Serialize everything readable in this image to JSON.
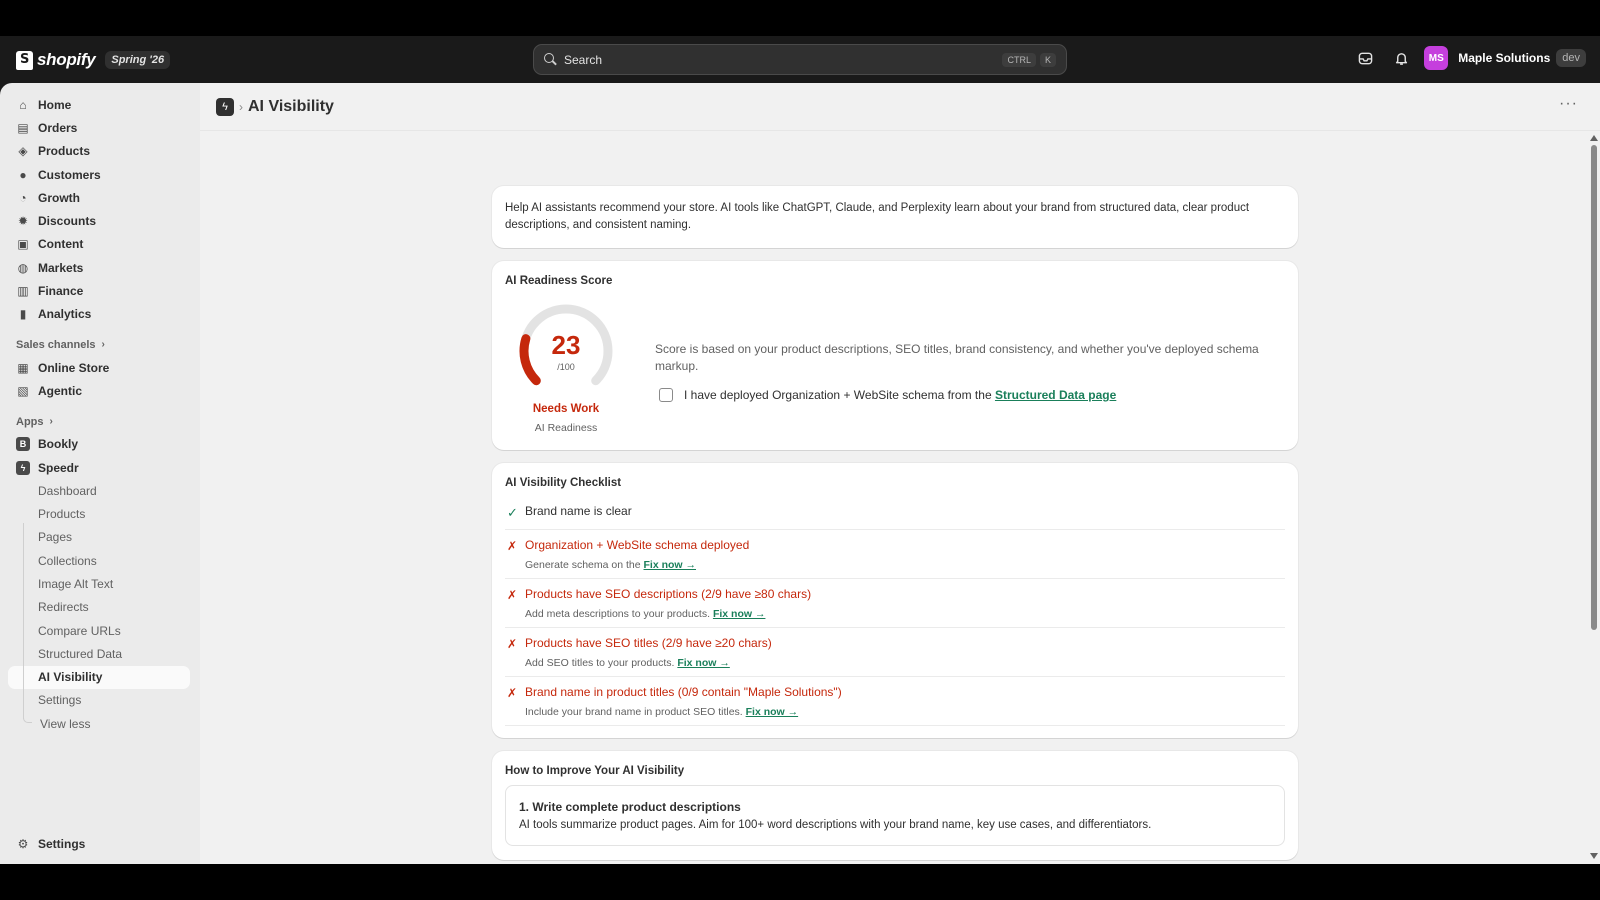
{
  "topbar": {
    "brand": "shopify",
    "edition_badge": "Spring '26",
    "search_placeholder": "Search",
    "kbd_ctrl": "CTRL",
    "kbd_k": "K",
    "avatar_initials": "MS",
    "store_name": "Maple Solutions",
    "env_badge": "dev"
  },
  "sidebar": {
    "main_items": [
      {
        "label": "Home",
        "icon": "home-icon"
      },
      {
        "label": "Orders",
        "icon": "orders-icon"
      },
      {
        "label": "Products",
        "icon": "tag-icon"
      },
      {
        "label": "Customers",
        "icon": "person-icon"
      },
      {
        "label": "Growth",
        "icon": "growth-icon"
      },
      {
        "label": "Discounts",
        "icon": "discount-icon"
      },
      {
        "label": "Content",
        "icon": "content-icon"
      },
      {
        "label": "Markets",
        "icon": "globe-icon"
      },
      {
        "label": "Finance",
        "icon": "bank-icon"
      },
      {
        "label": "Analytics",
        "icon": "bar-chart-icon"
      }
    ],
    "sales_channels_header": "Sales channels",
    "sales_channels": [
      {
        "label": "Online Store",
        "icon": "store-icon"
      },
      {
        "label": "Agentic",
        "icon": "agentic-icon"
      }
    ],
    "apps_header": "Apps",
    "apps": [
      {
        "label": "Bookly",
        "icon": "bookly-icon"
      },
      {
        "label": "Speedr",
        "icon": "speedr-icon"
      }
    ],
    "speedr_sub": [
      "Dashboard",
      "Products",
      "Pages",
      "Collections",
      "Image Alt Text",
      "Redirects",
      "Compare URLs",
      "Structured Data",
      "AI Visibility",
      "Settings"
    ],
    "view_less": "View less",
    "settings": "Settings"
  },
  "page": {
    "title": "AI Visibility",
    "intro": "Help AI assistants recommend your store. AI tools like ChatGPT, Claude, and Perplexity learn about your brand from structured data, clear product descriptions, and consistent naming.",
    "readiness": {
      "title": "AI Readiness Score",
      "score": 23,
      "max_label": "/100",
      "status": "Needs Work",
      "caption": "AI Readiness",
      "description": "Score is based on your product descriptions, SEO titles, brand consistency, and whether you've deployed schema markup.",
      "checkbox_text": "I have deployed Organization + WebSite schema from the ",
      "checkbox_link": "Structured Data page",
      "checkbox_checked": false,
      "accent_color": "#c5280c"
    },
    "checklist": {
      "title": "AI Visibility Checklist",
      "items": [
        {
          "status": "ok",
          "mark": "✓",
          "title": "Brand name is clear",
          "hint": "",
          "link": ""
        },
        {
          "status": "bad",
          "mark": "✗",
          "title": "Organization + WebSite schema deployed",
          "hint": "Generate schema on the ",
          "link": "Fix now →"
        },
        {
          "status": "bad",
          "mark": "✗",
          "title": "Products have SEO descriptions (2/9 have ≥80 chars)",
          "hint": "Add meta descriptions to your products. ",
          "link": "Fix now →"
        },
        {
          "status": "bad",
          "mark": "✗",
          "title": "Products have SEO titles (2/9 have ≥20 chars)",
          "hint": "Add SEO titles to your products. ",
          "link": "Fix now →"
        },
        {
          "status": "bad",
          "mark": "✗",
          "title": "Brand name in product titles (0/9 contain \"Maple Solutions\")",
          "hint": "Include your brand name in product SEO titles. ",
          "link": "Fix now →"
        }
      ]
    },
    "improve": {
      "title": "How to Improve Your AI Visibility",
      "tips": [
        {
          "title": "1. Write complete product descriptions",
          "body": "AI tools summarize product pages. Aim for 100+ word descriptions with your brand name, key use cases, and differentiators."
        }
      ]
    }
  }
}
